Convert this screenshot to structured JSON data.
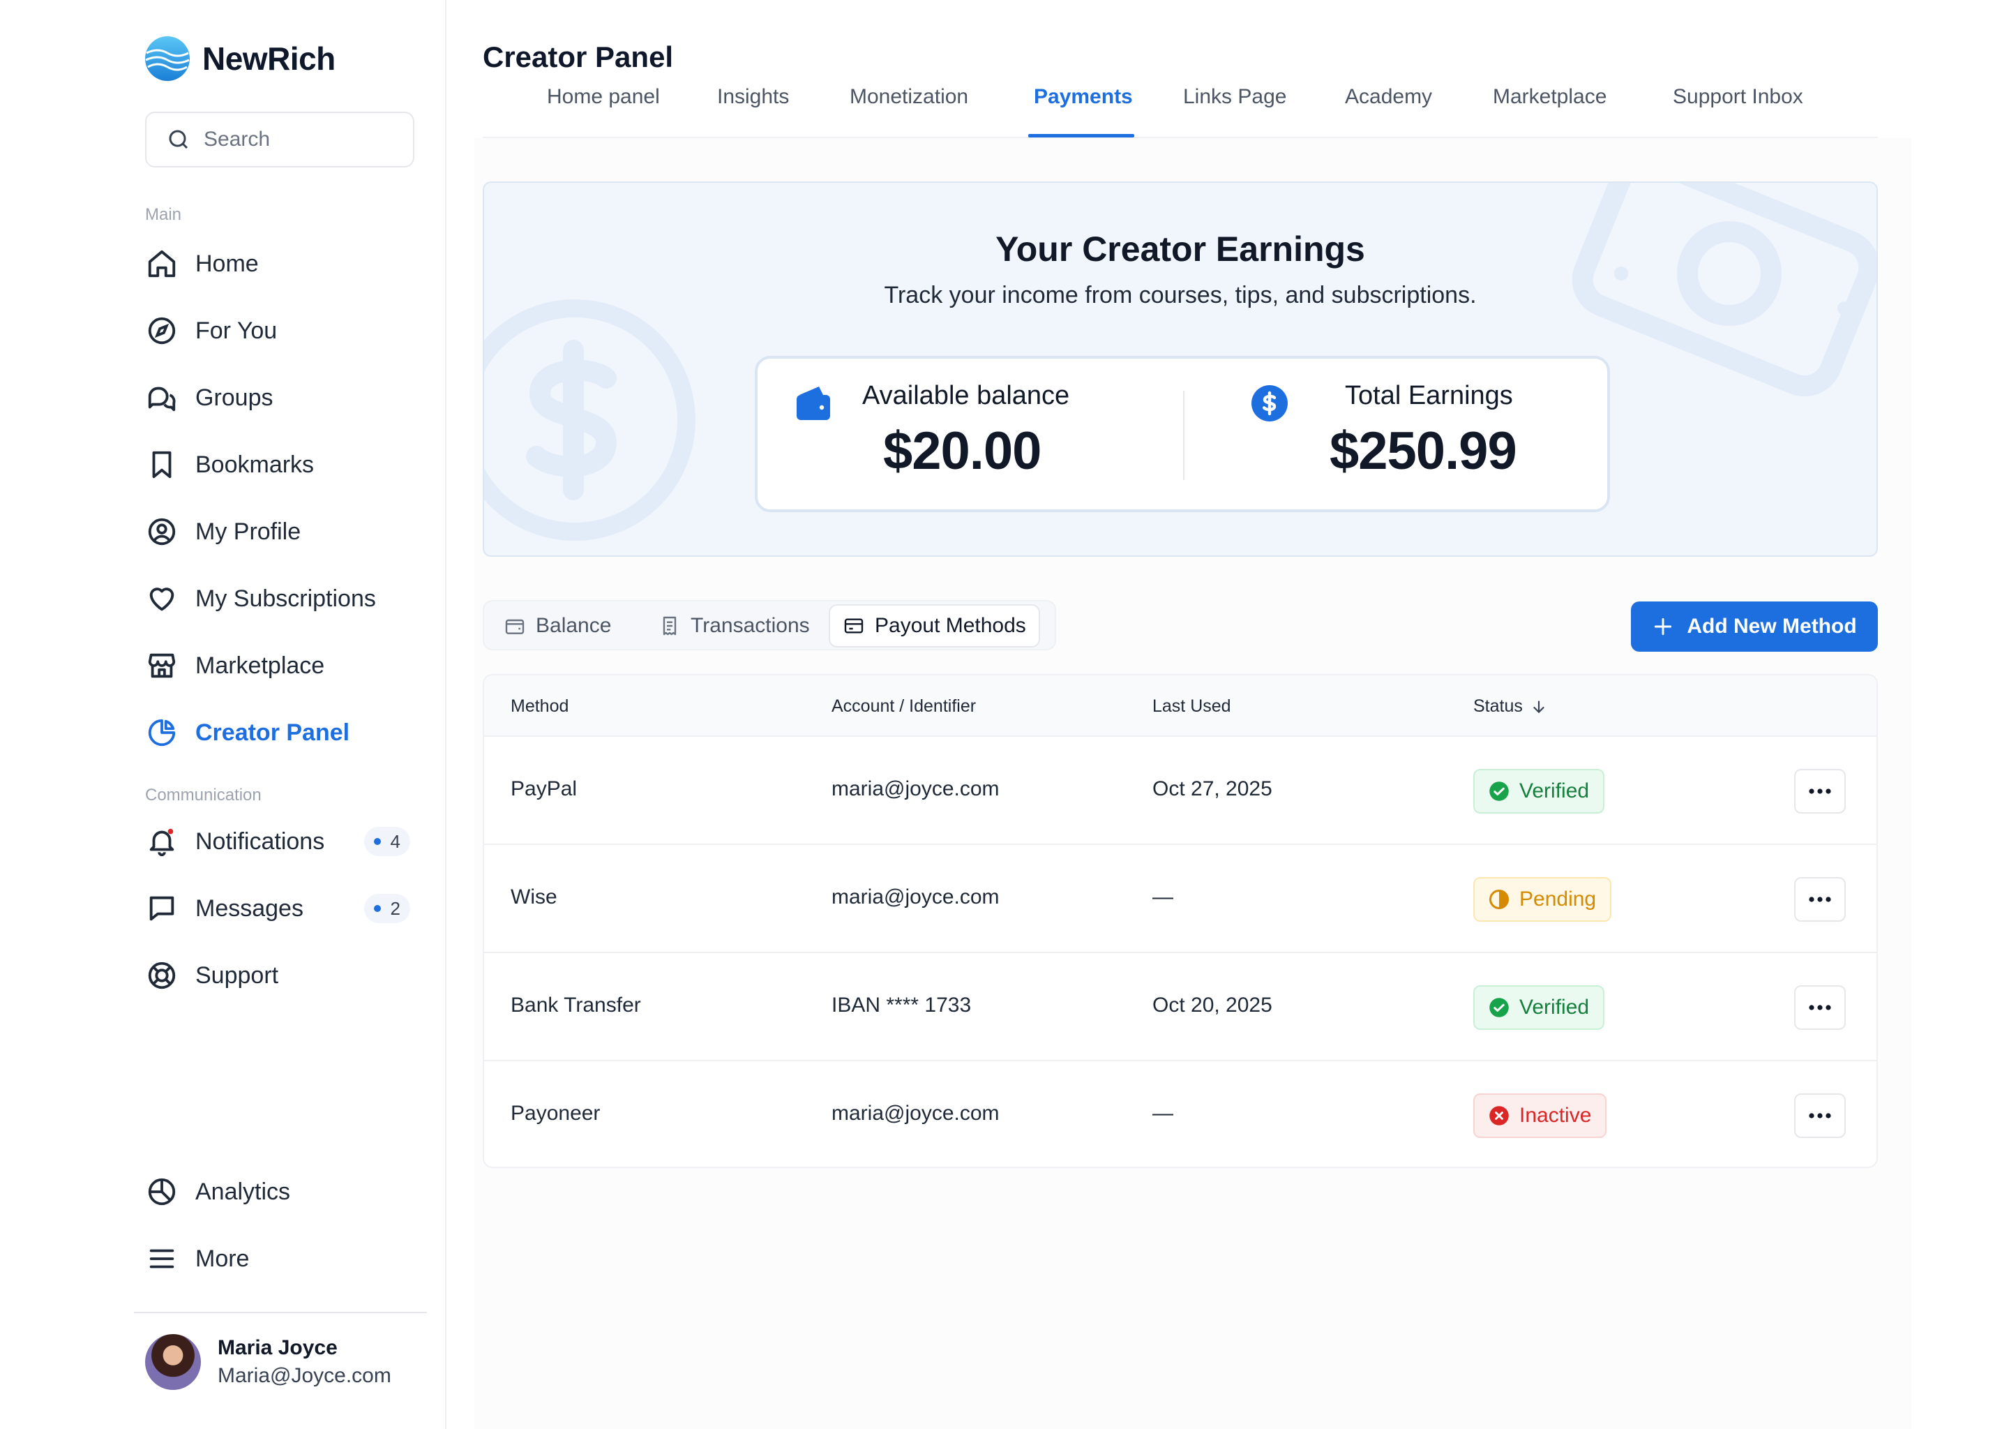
{
  "brand": {
    "name": "NewRich"
  },
  "search": {
    "placeholder": "Search"
  },
  "sidebar": {
    "main_label": "Main",
    "communication_label": "Communication",
    "items": [
      {
        "label": "Home",
        "icon": "home-icon"
      },
      {
        "label": "For You",
        "icon": "compass-icon"
      },
      {
        "label": "Groups",
        "icon": "chat-bubbles-icon"
      },
      {
        "label": "Bookmarks",
        "icon": "bookmark-icon"
      },
      {
        "label": "My Profile",
        "icon": "user-circle-icon"
      },
      {
        "label": "My Subscriptions",
        "icon": "heart-icon"
      },
      {
        "label": "Marketplace",
        "icon": "store-icon"
      },
      {
        "label": "Creator Panel",
        "icon": "pie-chart-icon",
        "active": true
      }
    ],
    "communication": [
      {
        "label": "Notifications",
        "icon": "bell-icon",
        "badge": "4"
      },
      {
        "label": "Messages",
        "icon": "message-icon",
        "badge": "2"
      },
      {
        "label": "Support",
        "icon": "lifebuoy-icon"
      }
    ],
    "bottom": [
      {
        "label": "Analytics",
        "icon": "analytics-icon"
      },
      {
        "label": "More",
        "icon": "menu-icon"
      }
    ],
    "profile": {
      "name": "Maria Joyce",
      "email": "Maria@Joyce.com"
    }
  },
  "page": {
    "title": "Creator Panel",
    "tabs": [
      {
        "label": "Home panel"
      },
      {
        "label": "Insights"
      },
      {
        "label": "Monetization"
      },
      {
        "label": "Payments",
        "active": true
      },
      {
        "label": "Links Page"
      },
      {
        "label": "Academy"
      },
      {
        "label": "Marketplace"
      },
      {
        "label": "Support Inbox"
      }
    ]
  },
  "hero": {
    "title": "Your Creator Earnings",
    "subtitle": "Track your income from courses, tips, and subscriptions.",
    "available_label": "Available balance",
    "available_value": "$20.00",
    "total_label": "Total Earnings",
    "total_value": "$250.99"
  },
  "segments": [
    {
      "label": "Balance",
      "icon": "wallet-icon"
    },
    {
      "label": "Transactions",
      "icon": "receipt-icon"
    },
    {
      "label": "Payout Methods",
      "icon": "card-icon",
      "active": true
    }
  ],
  "add_button": {
    "label": "Add New Method"
  },
  "table": {
    "headers": {
      "method": "Method",
      "account": "Account / Identifier",
      "last_used": "Last Used",
      "status": "Status"
    },
    "rows": [
      {
        "method": "PayPal",
        "account": "maria@joyce.com",
        "last_used": "Oct 27, 2025",
        "status": "Verified",
        "status_type": "verified"
      },
      {
        "method": "Wise",
        "account": "maria@joyce.com",
        "last_used": "—",
        "status": "Pending",
        "status_type": "pending"
      },
      {
        "method": "Bank Transfer",
        "account": "IBAN **** 1733",
        "last_used": "Oct 20, 2025",
        "status": "Verified",
        "status_type": "verified"
      },
      {
        "method": "Payoneer",
        "account": "maria@joyce.com",
        "last_used": "—",
        "status": "Inactive",
        "status_type": "inactive"
      }
    ]
  },
  "colors": {
    "accent": "#1d6fe0",
    "verified": "#15803d",
    "pending": "#d68a00",
    "inactive": "#dc2626"
  }
}
